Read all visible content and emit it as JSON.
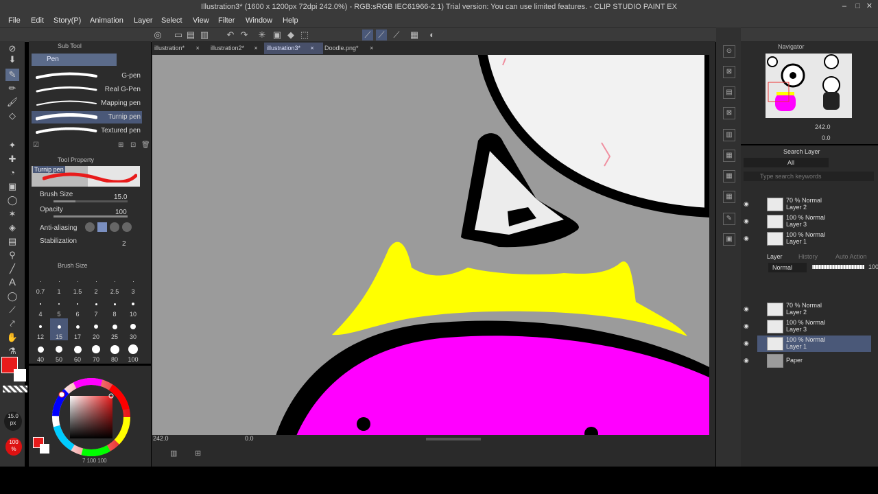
{
  "window": {
    "title": "Illustration3* (1600 x 1200px 72dpi 242.0%) - RGB:sRGB IEC61966-2.1) Trial version: You can use limited features. - CLIP STUDIO PAINT EX"
  },
  "menu": [
    "File",
    "Edit",
    "Story(P)",
    "Animation",
    "Layer",
    "Select",
    "View",
    "Filter",
    "Window",
    "Help"
  ],
  "sub_tool": {
    "header": "Sub Tool",
    "group": "Pen",
    "brushes": [
      {
        "label": "G-pen"
      },
      {
        "label": "Real G-Pen"
      },
      {
        "label": "Mapping pen"
      },
      {
        "label": "Turnip pen"
      },
      {
        "label": "Textured pen"
      }
    ],
    "selected_brush": "Turnip pen"
  },
  "tool_property": {
    "header": "Tool Property",
    "preview_label": "Turnip pen",
    "brush_size_label": "Brush Size",
    "brush_size_value": "15.0",
    "opacity_label": "Opacity",
    "opacity_value": "100",
    "antialias_label": "Anti-aliasing",
    "stabilization_label": "Stabilization",
    "stabilization_value": "2"
  },
  "brush_size_panel": {
    "header": "Brush Size",
    "sizes": [
      "0.7",
      "1",
      "1.5",
      "2",
      "2.5",
      "3",
      "4",
      "5",
      "6",
      "7",
      "8",
      "10",
      "12",
      "15",
      "17",
      "20",
      "25",
      "30",
      "40",
      "50",
      "60",
      "70",
      "80",
      "100"
    ],
    "selected": "15"
  },
  "left_indicator": {
    "size_value": "15.0",
    "size_unit": "px",
    "opacity_value": "100",
    "opacity_unit": "%"
  },
  "color_panel": {
    "main_color": "#e81b1b",
    "sub_color": "#ffffff",
    "footer": "7 100 100"
  },
  "tabs": [
    {
      "label": "illustration*"
    },
    {
      "label": "illustration2*"
    },
    {
      "label": "illustration3*"
    },
    {
      "label": "Doodle.png*"
    }
  ],
  "status": {
    "zoom": "242.0",
    "angle": "0.0"
  },
  "navigator": {
    "header": "Navigator",
    "zoom": "242.0",
    "rotation": "0.0"
  },
  "search_layer": {
    "header": "Search Layer",
    "filter": "All",
    "placeholder": "Type search keywords"
  },
  "layer_panel": {
    "tab_layer": "Layer",
    "tab_history": "History",
    "tab_auto": "Auto Action",
    "blend_mode": "Normal",
    "opacity": "100",
    "layers": [
      {
        "line1": "70 % Normal",
        "line2": "Layer 2",
        "selected": false
      },
      {
        "line1": "100 % Normal",
        "line2": "Layer 3",
        "selected": false
      },
      {
        "line1": "100 % Normal",
        "line2": "Layer 1",
        "selected": true
      },
      {
        "line1": "",
        "line2": "Paper",
        "selected": false
      }
    ],
    "search_results": [
      {
        "line1": "70 % Normal",
        "line2": "Layer 2"
      },
      {
        "line1": "100 % Normal",
        "line2": "Layer 3"
      },
      {
        "line1": "100 % Normal",
        "line2": "Layer 1"
      }
    ]
  },
  "colors": {
    "accent": "#4a5878",
    "canvas_bg": "#9b9b9b",
    "yellow": "#ffff00",
    "magenta": "#ff00ff"
  }
}
